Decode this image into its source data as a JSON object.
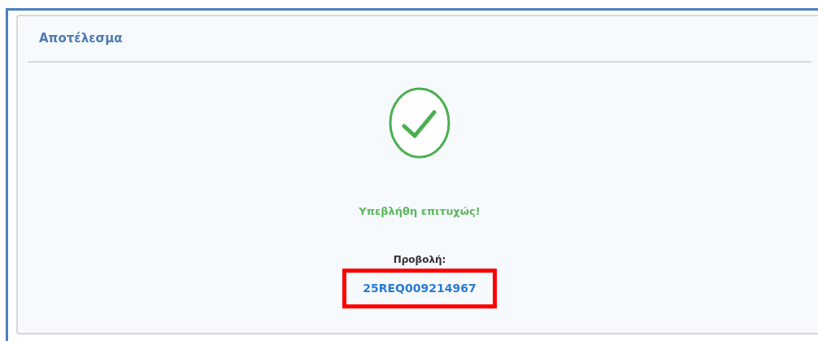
{
  "panel": {
    "title": "Αποτέλεσμα"
  },
  "result": {
    "succeeded": true,
    "message": "Υπεβλήθη επιτυχώς!",
    "view_label": "Προβολή:",
    "reference": "25REQ009214967",
    "highlighted": true
  }
}
